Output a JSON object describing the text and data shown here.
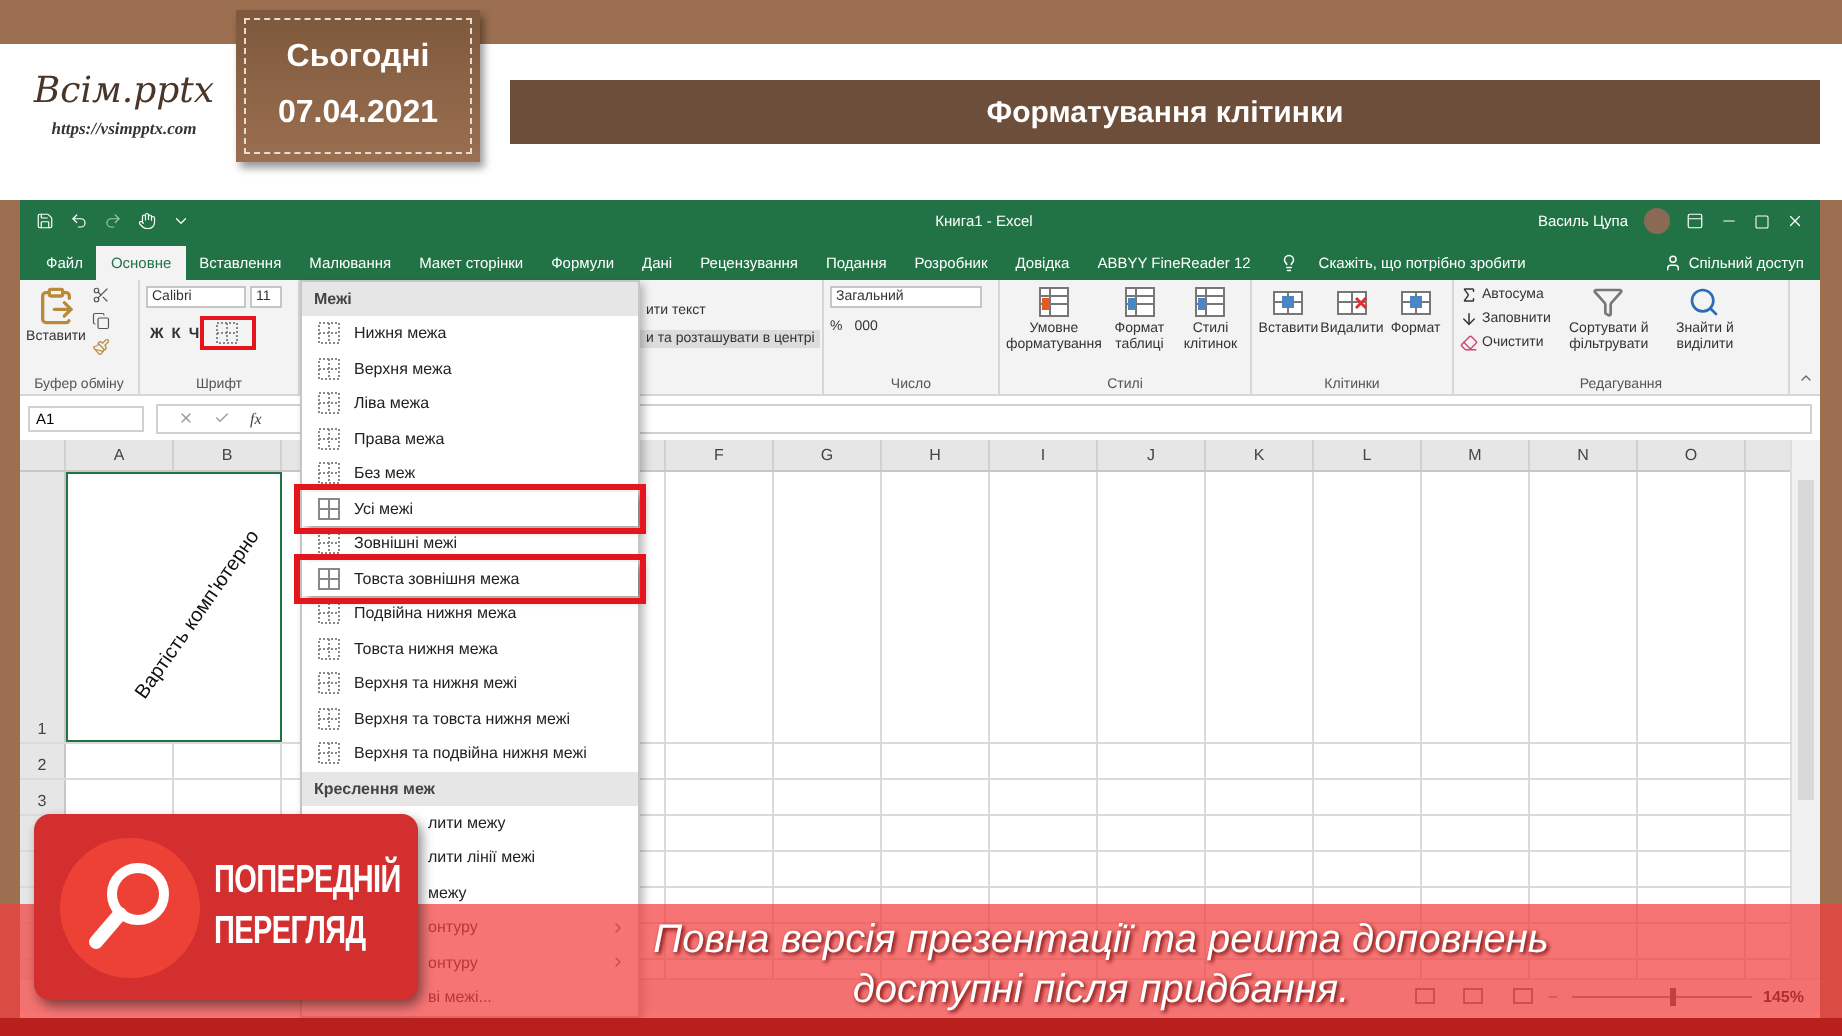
{
  "slide": {
    "logo": {
      "name": "Всім.pptx",
      "url": "https://vsimpptx.com"
    },
    "date_tag": {
      "label": "Сьогодні",
      "date": "07.04.2021"
    },
    "title": "Форматування клітинки"
  },
  "excel": {
    "title": "Книга1 - Excel",
    "user": "Василь Цупа",
    "tabs": [
      {
        "label": "Файл",
        "selected": false
      },
      {
        "label": "Основне",
        "selected": true
      },
      {
        "label": "Вставлення",
        "selected": false
      },
      {
        "label": "Малювання",
        "selected": false
      },
      {
        "label": "Макет сторінки",
        "selected": false
      },
      {
        "label": "Формули",
        "selected": false
      },
      {
        "label": "Дані",
        "selected": false
      },
      {
        "label": "Рецензування",
        "selected": false
      },
      {
        "label": "Подання",
        "selected": false
      },
      {
        "label": "Розробник",
        "selected": false
      },
      {
        "label": "Довідка",
        "selected": false
      },
      {
        "label": "ABBYY FineReader 12",
        "selected": false
      }
    ],
    "tell_me": "Скажіть, що потрібно зробити",
    "share": "Спільний доступ",
    "ribbon": {
      "clipboard": {
        "label": "Буфер обміну",
        "paste": "Вставити"
      },
      "font": {
        "label": "Шрифт",
        "font_name": "Calibri",
        "font_size": "11",
        "styles": [
          "Ж",
          "К",
          "Ч"
        ],
        "borders_button": {
          "highlighted": true
        }
      },
      "alignment": {
        "wrap": "ити текст",
        "merge": "и та розташувати в центрі"
      },
      "number": {
        "label": "Число",
        "format": "Загальний",
        "percent": "%",
        "thousands": "000"
      },
      "styles": {
        "label": "Стилі",
        "buttons": [
          "Умовне форматування",
          "Формат таблиці",
          "Стилі клітинок"
        ]
      },
      "cells": {
        "label": "Клітинки",
        "buttons": [
          "Вставити",
          "Видалити",
          "Формат"
        ]
      },
      "editing": {
        "label": "Редагування",
        "small": [
          "Автосума",
          "Заповнити",
          "Очистити"
        ],
        "buttons": [
          "Сортувати й фільтрувати",
          "Знайти й виділити"
        ]
      }
    },
    "name_box": "A1",
    "formula_icon": "fx",
    "columns_left": [
      "A",
      "B"
    ],
    "columns_right": [
      "F",
      "G",
      "H",
      "I",
      "J",
      "K",
      "L",
      "M",
      "N",
      "O"
    ],
    "rows": [
      "1",
      "2",
      "3"
    ],
    "cell_a1": "Вартість комп'ютерно",
    "zoom": {
      "label": "145%",
      "level": 0.55
    }
  },
  "borders_menu": {
    "title": "Межі",
    "items": [
      {
        "label": "Нижня межа",
        "highlighted": false
      },
      {
        "label": "Верхня межа",
        "highlighted": false
      },
      {
        "label": "Ліва межа",
        "highlighted": false
      },
      {
        "label": "Права межа",
        "highlighted": false
      },
      {
        "label": "Без меж",
        "highlighted": false
      },
      {
        "label": "Усі межі",
        "highlighted": true
      },
      {
        "label": "Зовнішні межі",
        "highlighted": false
      },
      {
        "label": "Товста зовнішня межа",
        "highlighted": true
      },
      {
        "label": "Подвійна нижня межа",
        "highlighted": false
      },
      {
        "label": "Товста нижня межа",
        "highlighted": false
      },
      {
        "label": "Верхня та нижня межі",
        "highlighted": false
      },
      {
        "label": "Верхня та товста нижня межі",
        "highlighted": false
      },
      {
        "label": "Верхня та подвійна нижня межі",
        "highlighted": false
      }
    ],
    "section": "Креслення меж",
    "draw_items": [
      {
        "label": "лити межу",
        "submenu": false
      },
      {
        "label": "лити лінії межі",
        "submenu": false
      },
      {
        "label": "межу",
        "submenu": false
      },
      {
        "label": "онтуру",
        "submenu": true
      },
      {
        "label": "онтуру",
        "submenu": true
      },
      {
        "label": "ві межі...",
        "submenu": false
      }
    ]
  },
  "preview_banner": {
    "badge_lines": [
      "ПОПЕРЕДНІЙ",
      "ПЕРЕГЛЯД"
    ],
    "message": "Повна версія презентації та решта доповнень доступні після придбання."
  }
}
